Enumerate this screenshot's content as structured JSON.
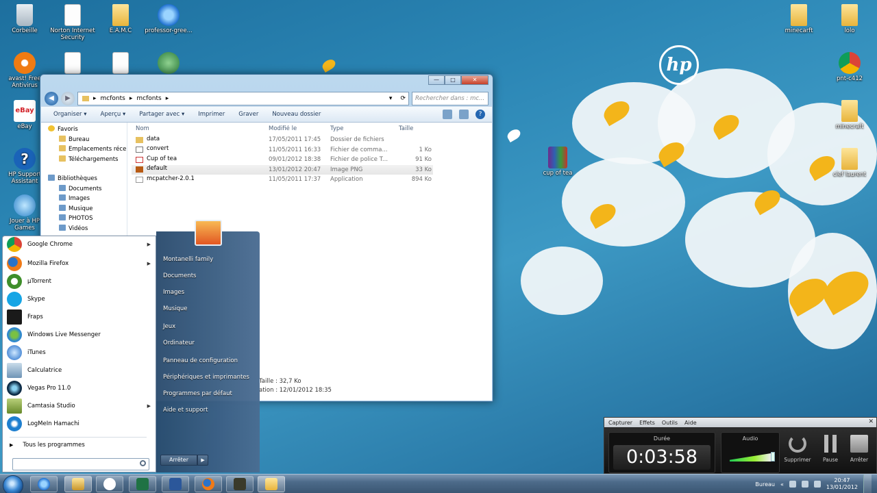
{
  "desktop": {
    "icons_left": [
      {
        "label": "Corbeille",
        "icon": "trash-icon"
      },
      {
        "label": "Norton Internet Security",
        "icon": "document-icon"
      },
      {
        "label": "E.A.M.C",
        "icon": "folder-icon"
      },
      {
        "label": "professor-gree...",
        "icon": "ie-icon"
      },
      {
        "label": "avast! Free Antivirus",
        "icon": "avast-icon"
      },
      {
        "label": "eBay",
        "icon": "ebay-icon"
      },
      {
        "label": "HP Support Assistant",
        "icon": "help-icon"
      },
      {
        "label": "Jouer à HP Games",
        "icon": "hp-games-icon"
      }
    ],
    "icons_right": [
      {
        "label": "minecarft",
        "icon": "folder-icon"
      },
      {
        "label": "lolo",
        "icon": "folder-icon"
      },
      {
        "label": "pnt-c412",
        "icon": "chrome-icon"
      },
      {
        "label": "minecraft",
        "icon": "folder-icon"
      },
      {
        "label": "clef laurent",
        "icon": "folder-icon"
      },
      {
        "label": "cup of tea",
        "icon": "winrar-icon"
      }
    ],
    "wallpaper_brand": "hp"
  },
  "explorer": {
    "breadcrumb": [
      "mcfonts",
      "mcfonts"
    ],
    "search_placeholder": "Rechercher dans : mc...",
    "toolbar": [
      "Organiser ▾",
      "Aperçu ▾",
      "Partager avec ▾",
      "Imprimer",
      "Graver",
      "Nouveau dossier"
    ],
    "nav": {
      "favoris": "Favoris",
      "fav_items": [
        "Bureau",
        "Emplacements récen",
        "Téléchargements"
      ],
      "bibliotheques": "Bibliothèques",
      "lib_items": [
        "Documents",
        "Images",
        "Musique",
        "PHOTOS",
        "Vidéos"
      ]
    },
    "columns": [
      "Nom",
      "Modifié le",
      "Type",
      "Taille"
    ],
    "files": [
      {
        "name": "data",
        "modified": "17/05/2011 17:45",
        "type": "Dossier de fichiers",
        "size": "",
        "icon": "folder-icon"
      },
      {
        "name": "convert",
        "modified": "11/05/2011 16:33",
        "type": "Fichier de comma...",
        "size": "1 Ko",
        "icon": "cmd-icon"
      },
      {
        "name": "Cup of tea",
        "modified": "09/01/2012 18:38",
        "type": "Fichier de police T...",
        "size": "91 Ko",
        "icon": "font-icon"
      },
      {
        "name": "default",
        "modified": "13/01/2012 20:47",
        "type": "Image PNG",
        "size": "33 Ko",
        "icon": "image-icon"
      },
      {
        "name": "mcpatcher-2.0.1",
        "modified": "11/05/2011 17:37",
        "type": "Application",
        "size": "894 Ko",
        "icon": "app-icon"
      }
    ],
    "details_size": "Taille : 32,7 Ko",
    "details_date": "ation : 12/01/2012 18:35"
  },
  "start_menu": {
    "programs": [
      {
        "label": "Google Chrome",
        "icon": "chrome",
        "arrow": true
      },
      {
        "label": "Mozilla Firefox",
        "icon": "firefox",
        "arrow": true
      },
      {
        "label": "µTorrent",
        "icon": "utorrent",
        "arrow": false
      },
      {
        "label": "Skype",
        "icon": "skype",
        "arrow": false
      },
      {
        "label": "Fraps",
        "icon": "fraps",
        "arrow": false
      },
      {
        "label": "Windows Live Messenger",
        "icon": "wlm",
        "arrow": false
      },
      {
        "label": "iTunes",
        "icon": "itunes",
        "arrow": false
      },
      {
        "label": "Calculatrice",
        "icon": "calc",
        "arrow": false
      },
      {
        "label": "Vegas Pro 11.0",
        "icon": "vegas",
        "arrow": false
      },
      {
        "label": "Camtasia Studio",
        "icon": "camtasia",
        "arrow": true
      },
      {
        "label": "LogMeIn Hamachi",
        "icon": "hamachi",
        "arrow": false
      }
    ],
    "all_programs": "Tous les programmes",
    "right_links": [
      "Montanelli family",
      "Documents",
      "Images",
      "Musique",
      "Jeux",
      "Ordinateur",
      "Panneau de configuration",
      "Périphériques et imprimantes",
      "Programmes par défaut",
      "Aide et support"
    ],
    "shutdown": "Arrêter"
  },
  "recorder": {
    "menu": [
      "Capturer",
      "Effets",
      "Outils",
      "Aide"
    ],
    "duration_label": "Durée",
    "time": "0:03:58",
    "audio_label": "Audio",
    "buttons": [
      "Supprimer",
      "Pause",
      "Arrêter"
    ]
  },
  "taskbar": {
    "apps": [
      "ie-icon",
      "explorer-icon",
      "hp-icon",
      "excel-icon",
      "word-icon",
      "firefox-icon",
      "minecraft-icon",
      "folder-icon"
    ],
    "tray_label": "Bureau",
    "time": "20:47",
    "date": "13/01/2012"
  }
}
